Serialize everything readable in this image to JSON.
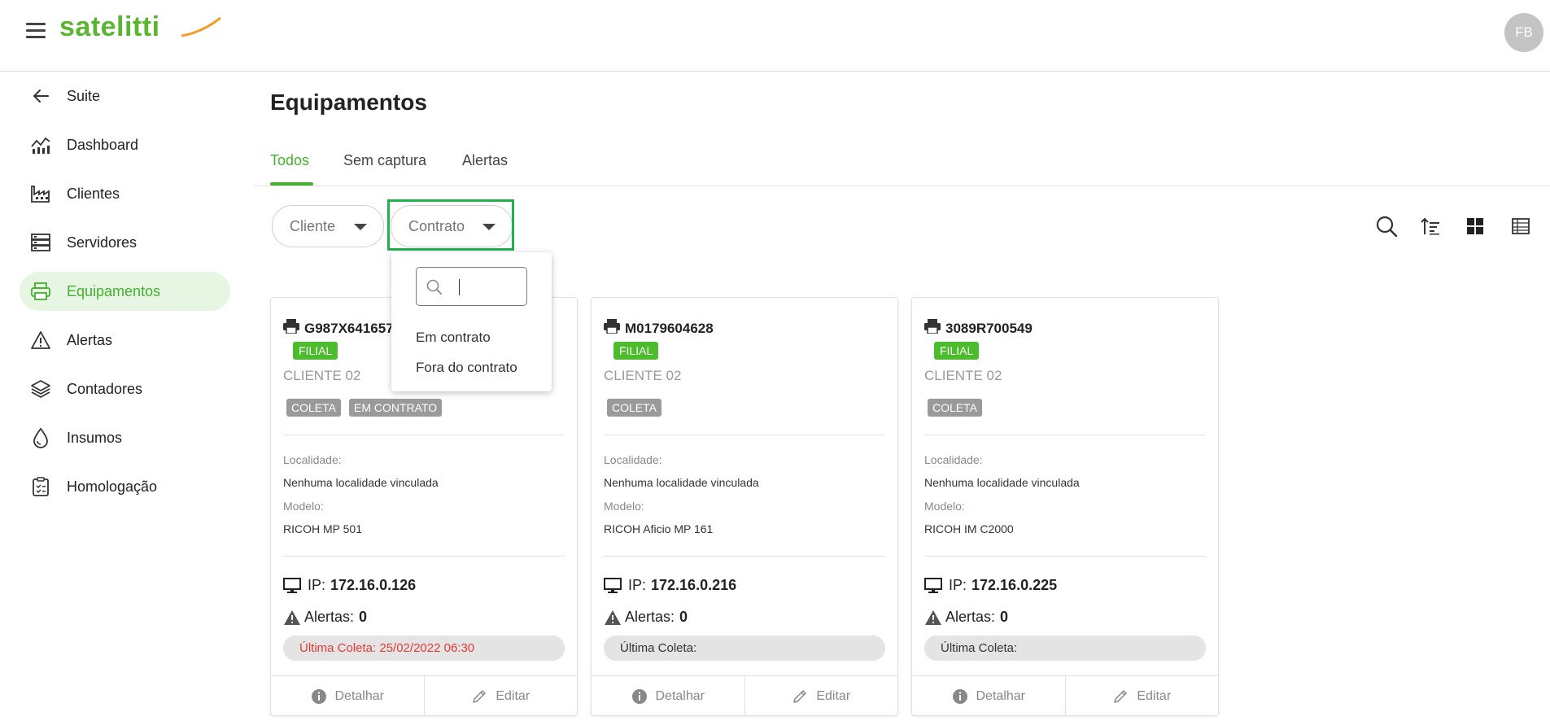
{
  "header": {
    "logo_text": "satelitti",
    "avatar_initials": "FB"
  },
  "sidebar": {
    "items": [
      {
        "label": "Suite",
        "icon": "arrow-left-icon"
      },
      {
        "label": "Dashboard",
        "icon": "dashboard-chart-icon"
      },
      {
        "label": "Clientes",
        "icon": "factory-icon"
      },
      {
        "label": "Servidores",
        "icon": "server-icon"
      },
      {
        "label": "Equipamentos",
        "icon": "printer-icon",
        "active": true
      },
      {
        "label": "Alertas",
        "icon": "warning-icon"
      },
      {
        "label": "Contadores",
        "icon": "layers-icon"
      },
      {
        "label": "Insumos",
        "icon": "drop-icon"
      },
      {
        "label": "Homologação",
        "icon": "clipboard-icon"
      }
    ]
  },
  "page": {
    "title": "Equipamentos",
    "tabs": [
      {
        "label": "Todos",
        "active": true
      },
      {
        "label": "Sem captura"
      },
      {
        "label": "Alertas"
      }
    ]
  },
  "filters": {
    "cliente": "Cliente",
    "contrato": "Contrato"
  },
  "dropdown": {
    "search_value": "",
    "options": [
      "Em contrato",
      "Fora do contrato"
    ]
  },
  "toolbar": {
    "icons": [
      "search-icon",
      "sort-icon",
      "grid-view-icon",
      "table-view-icon"
    ]
  },
  "labels": {
    "localidade": "Localidade:",
    "modelo": "Modelo:",
    "ip": "IP:",
    "alertas": "Alertas:",
    "detalhar": "Detalhar",
    "editar": "Editar"
  },
  "cards": [
    {
      "serial": "G987X641657",
      "badge": "FILIAL",
      "client": "CLIENTE 02",
      "tags": [
        "COLETA",
        "EM CONTRATO"
      ],
      "localidade": "Nenhuma localidade vinculada",
      "modelo": "RICOH MP 501",
      "ip": "172.16.0.126",
      "alertas": "0",
      "ultima_coleta": "Última Coleta: 25/02/2022 06:30",
      "coleta_status_color": "#e53935"
    },
    {
      "serial": "M0179604628",
      "badge": "FILIAL",
      "client": "CLIENTE 02",
      "tags": [
        "COLETA"
      ],
      "localidade": "Nenhuma localidade vinculada",
      "modelo": "RICOH Aficio MP 161",
      "ip": "172.16.0.216",
      "alertas": "0",
      "ultima_coleta": "Última Coleta:"
    },
    {
      "serial": "3089R700549",
      "badge": "FILIAL",
      "client": "CLIENTE 02",
      "tags": [
        "COLETA"
      ],
      "localidade": "Nenhuma localidade vinculada",
      "modelo": "RICOH IM C2000",
      "ip": "172.16.0.225",
      "alertas": "0",
      "ultima_coleta": "Última Coleta:"
    }
  ],
  "colors": {
    "accent": "#42b12d",
    "active_bg": "#e7f6e3",
    "highlight_border": "#22b14c",
    "tag_gray": "#9a9a9a"
  }
}
